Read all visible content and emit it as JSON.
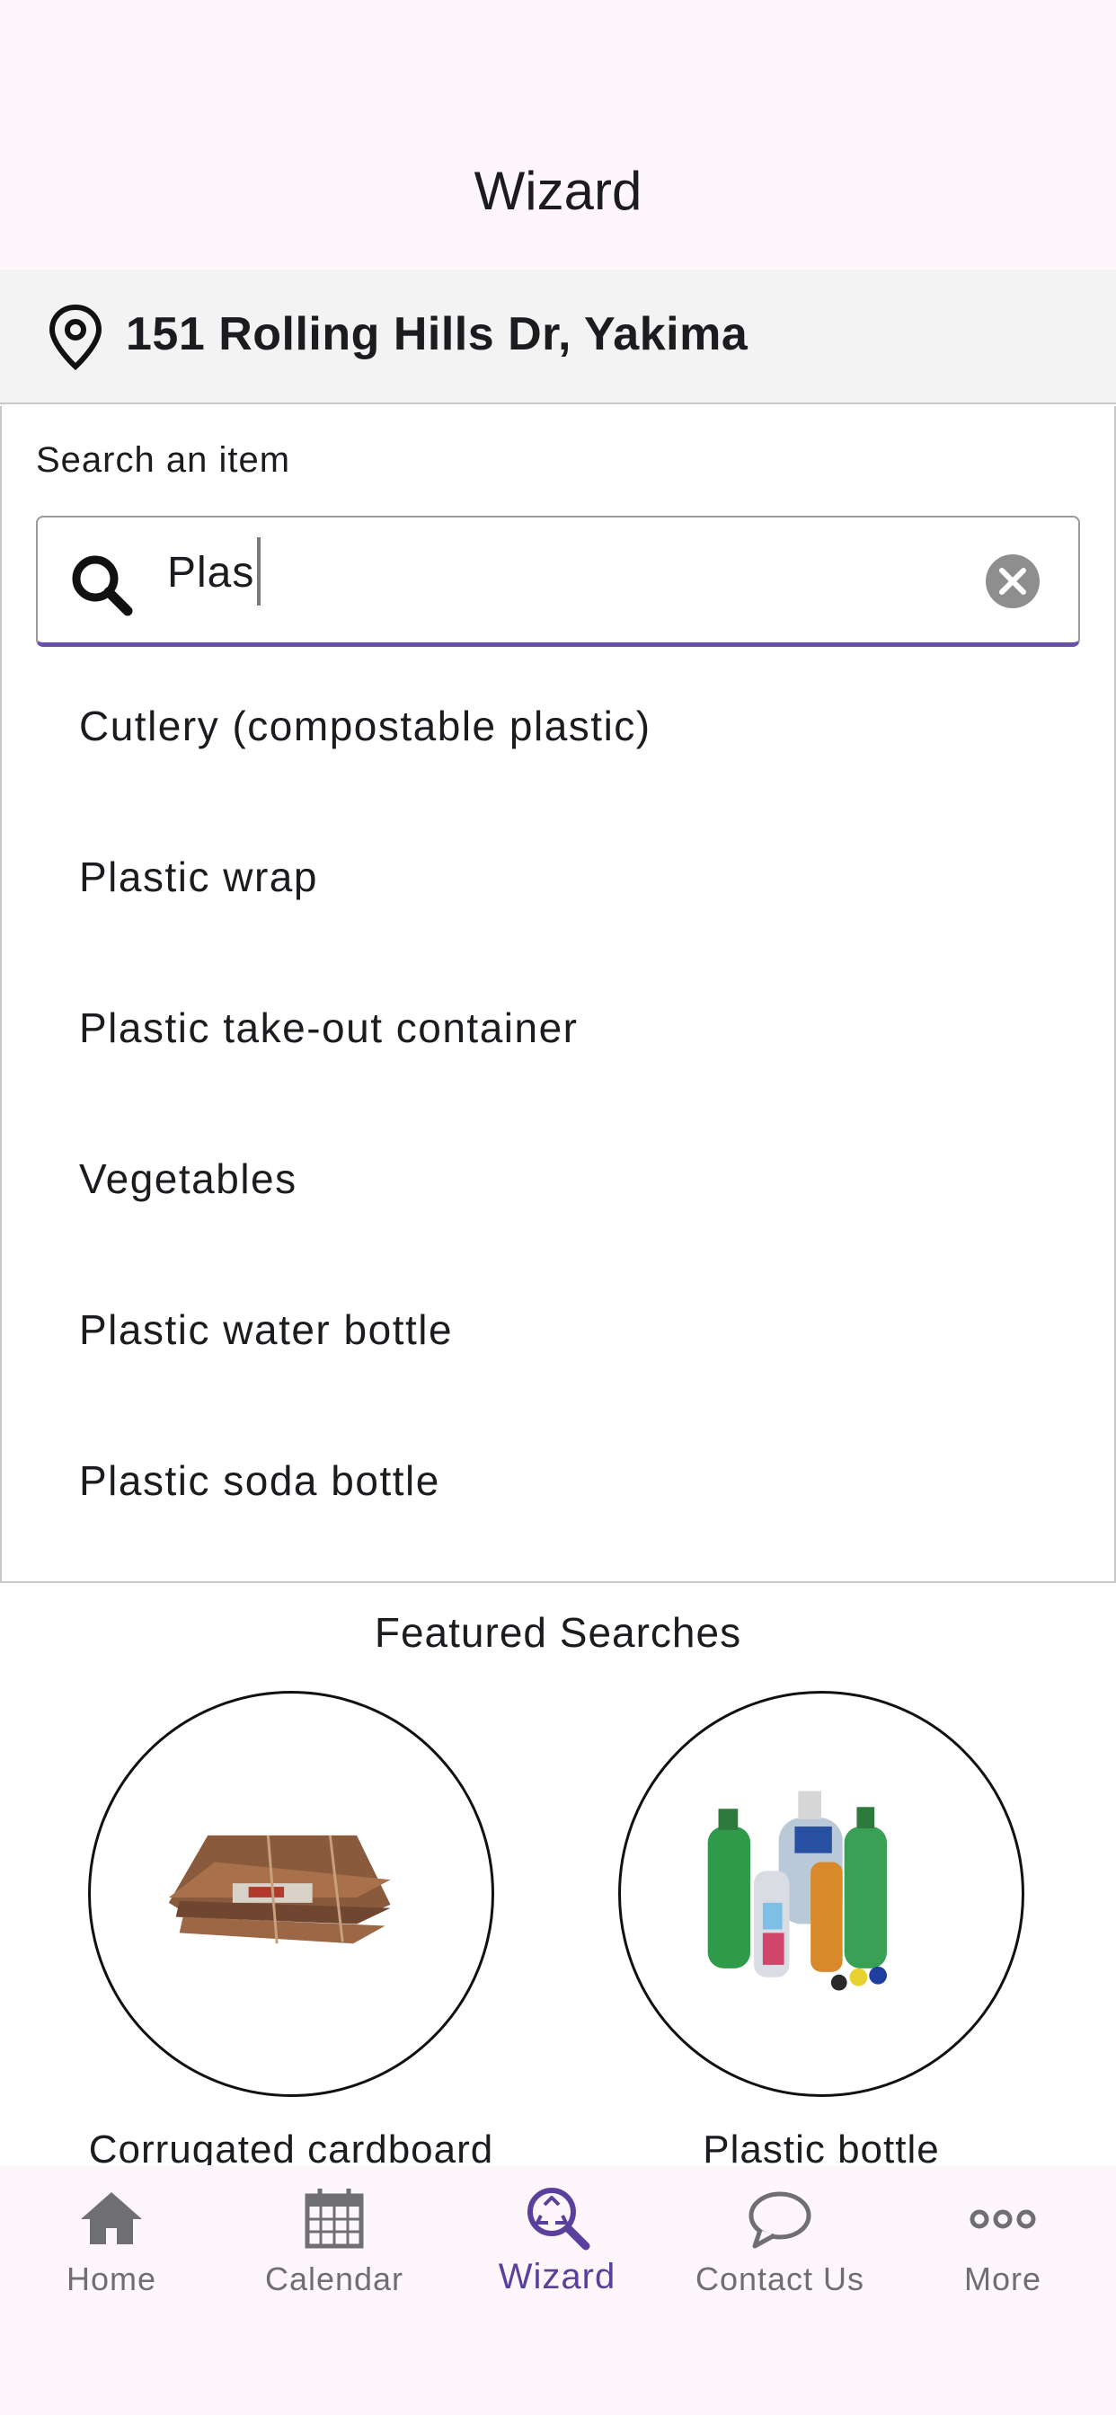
{
  "header": {
    "title": "Wizard"
  },
  "address": {
    "text": "151 Rolling Hills Dr, Yakima"
  },
  "search": {
    "label": "Search an item",
    "value": "Plas",
    "suggestions": [
      "Cutlery (compostable plastic)",
      "Plastic wrap",
      "Plastic take-out container",
      "Vegetables",
      "Plastic water bottle",
      "Plastic soda bottle"
    ]
  },
  "featured": {
    "title": "Featured Searches",
    "items": [
      {
        "label": "Corrugated cardboard",
        "image": "cardboard-stack"
      },
      {
        "label": "Plastic bottle",
        "image": "plastic-bottles"
      }
    ]
  },
  "nav": {
    "items": [
      {
        "label": "Home",
        "icon": "home-icon"
      },
      {
        "label": "Calendar",
        "icon": "calendar-icon"
      },
      {
        "label": "Wizard",
        "icon": "recycle-search-icon"
      },
      {
        "label": "Contact Us",
        "icon": "chat-bubble-icon"
      },
      {
        "label": "More",
        "icon": "more-dots-icon"
      }
    ],
    "active": "Wizard"
  },
  "colors": {
    "accent": "#5b3f9d",
    "header_bg": "#fdf7fc",
    "address_bg": "#f3f3f3"
  }
}
